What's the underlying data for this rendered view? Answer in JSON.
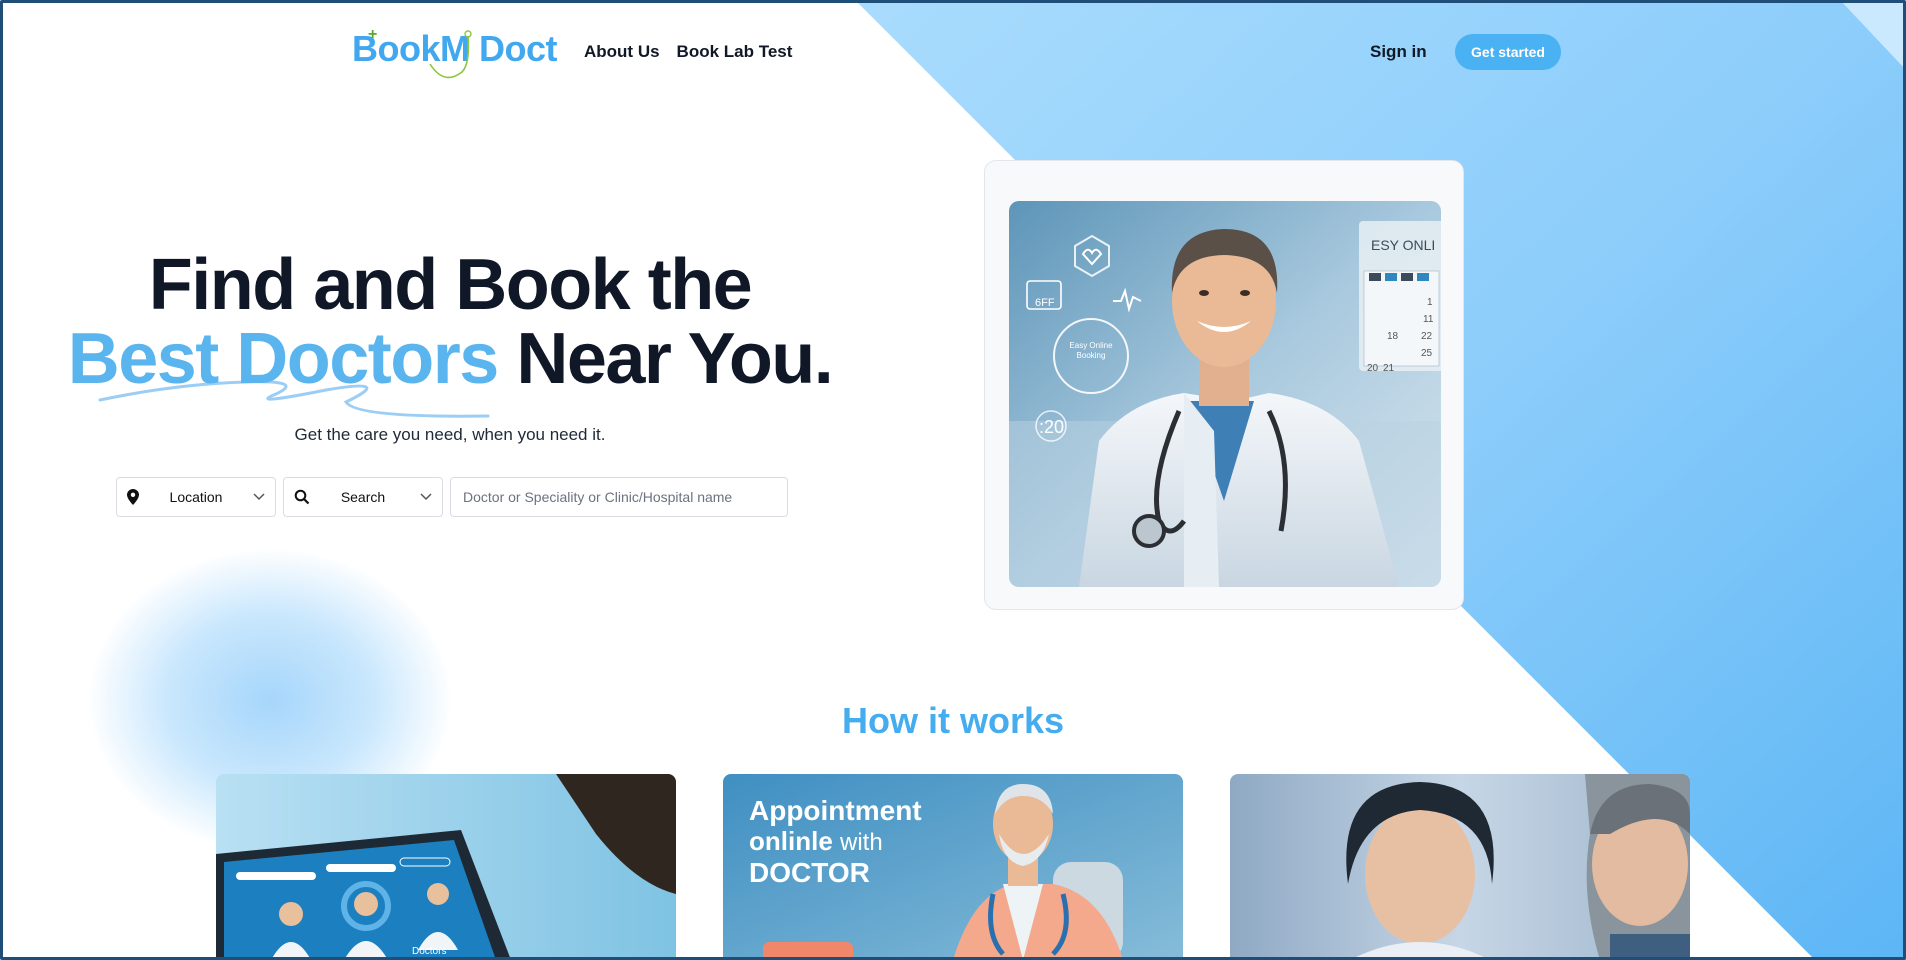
{
  "brand": {
    "logo_text": "BookM Doct",
    "accent": "#45acef"
  },
  "nav": {
    "about": "About Us",
    "lab": "Book Lab Test",
    "signin": "Sign in",
    "get_started": "Get started"
  },
  "hero": {
    "title_line1": "Find and Book the",
    "title_accent": "Best Doctors",
    "title_line2_rest": " Near You.",
    "subtitle": "Get the care you need, when you need it.",
    "location_label": "Location",
    "search_label": "Search",
    "query_placeholder": "Doctor or Speciality or Clinic/Hospital name"
  },
  "hero_image": {
    "overlay_labels": {
      "calendar_header": "ESY ONLI",
      "date_icon": "6FF",
      "clock_text": "Easy Online Booking",
      "time": ":20",
      "calendar_days": [
        "1",
        "11",
        "18",
        "22",
        "25",
        "20",
        "21"
      ]
    }
  },
  "how": {
    "title": "How it works",
    "cards": [
      {
        "search_label": "Doctors"
      },
      {
        "line1": "Appointment",
        "line2a": "onlinle",
        "line2b": "with",
        "line3": "DOCTOR"
      },
      {}
    ]
  },
  "colors": {
    "primary_button": "#4ab1f3",
    "title_dark": "#101828",
    "frame": "#1f4e79"
  }
}
